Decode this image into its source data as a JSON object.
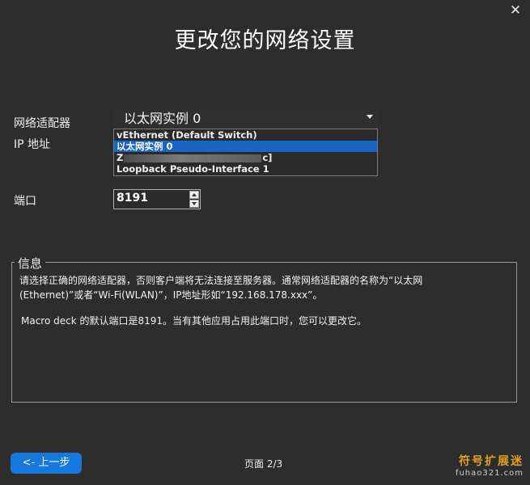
{
  "window": {
    "close_glyph": "✕",
    "title": "更改您的网络设置"
  },
  "form": {
    "adapter_label": "网络适配器",
    "ip_label": "IP 地址",
    "port_label": "端口",
    "adapter_selected": "以太网实例 0",
    "adapter_options": [
      "vEthernet (Default Switch)",
      "以太网实例 0",
      "Loopback Pseudo-Interface 1"
    ],
    "redacted_option_prefix": "Z",
    "redacted_option_suffix": "c]",
    "port_value": "8191"
  },
  "info": {
    "group_title": "信息",
    "line1": "请选择正确的网络适配器，否则客户端将无法连接至服务器。通常网络适配器的名称为“以太网",
    "line2": "(Ethernet)”或者“Wi-Fi(WLAN)”，IP地址形如“192.168.178.xxx”。",
    "line3": "Macro deck 的默认端口是8191。当有其他应用占用此端口时，您可以更改它。"
  },
  "footer": {
    "back_label": "<- 上一步",
    "page_label": "页面 2/3"
  },
  "watermark": {
    "main": "符号扩展迷",
    "url": "fuhao321.com"
  },
  "colors": {
    "background": "#2d2d2d",
    "accent": "#1677dd",
    "selection": "#1a64c6",
    "watermark": "#e0a020"
  },
  "icons": {
    "close": "close-icon",
    "dropdown": "chevron-down-icon",
    "spin_up": "spin-up-icon",
    "spin_down": "spin-down-icon"
  }
}
